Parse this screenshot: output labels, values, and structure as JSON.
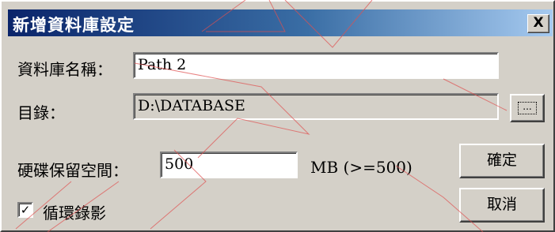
{
  "dialog": {
    "title": "新增資料庫設定",
    "close_label": "X"
  },
  "form": {
    "db_name_label": "資料庫名稱：",
    "db_name_value": "Path 2",
    "directory_label": "目錄：",
    "directory_value": "D:\\DATABASE",
    "browse_label": "...",
    "reserved_space_label": "硬碟保留空間：",
    "reserved_space_value": "500",
    "reserved_space_unit": "MB (>=500)",
    "loop_record_label": "循環錄影",
    "loop_record_checked": "✓"
  },
  "buttons": {
    "ok_label": "確定",
    "cancel_label": "取消"
  }
}
